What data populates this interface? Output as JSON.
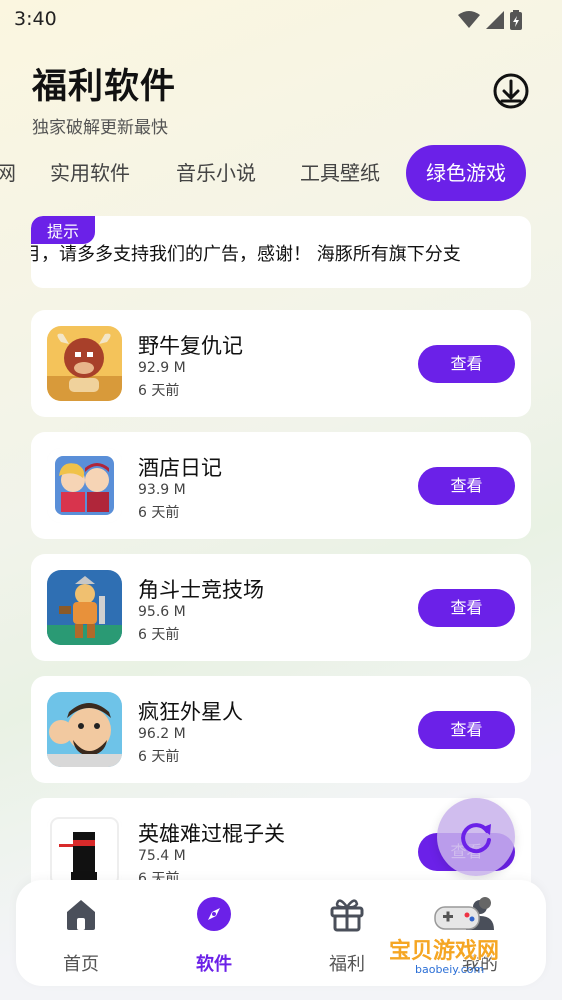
{
  "status_bar": {
    "time": "3:40"
  },
  "header": {
    "title": "福利软件",
    "subtitle": "独家破解更新最快"
  },
  "tabs": [
    {
      "label": "网"
    },
    {
      "label": "实用软件"
    },
    {
      "label": "音乐小说"
    },
    {
      "label": "工具壁纸"
    },
    {
      "label": "绿色游戏",
      "active": true
    }
  ],
  "notice": {
    "badge": "提示",
    "text": "月，请多多支持我们的广告，感谢！    海豚所有旗下分支"
  },
  "apps": [
    {
      "name": "野牛复仇记",
      "size": "92.9 M",
      "time": "6 天前",
      "button": "查看",
      "icon": "bull-game-icon"
    },
    {
      "name": "酒店日记",
      "size": "93.9 M",
      "time": "6 天前",
      "button": "查看",
      "icon": "hotel-game-icon"
    },
    {
      "name": "角斗士竞技场",
      "size": "95.6 M",
      "time": "6 天前",
      "button": "查看",
      "icon": "gladiator-game-icon"
    },
    {
      "name": "疯狂外星人",
      "size": "96.2 M",
      "time": "6 天前",
      "button": "查看",
      "icon": "alien-game-icon"
    },
    {
      "name": "英雄难过棍子关",
      "size": "75.4 M",
      "time": "6 天前",
      "button": "查看",
      "icon": "stick-hero-icon"
    }
  ],
  "bottom_nav": [
    {
      "label": "首页",
      "icon": "home-icon"
    },
    {
      "label": "软件",
      "icon": "compass-icon",
      "active": true
    },
    {
      "label": "福利",
      "icon": "gift-icon"
    },
    {
      "label": "我的",
      "icon": "user-icon"
    }
  ],
  "watermark": {
    "text": "宝贝游戏网",
    "sub": "baobeiy.com"
  },
  "colors": {
    "accent": "#6b21e8"
  }
}
